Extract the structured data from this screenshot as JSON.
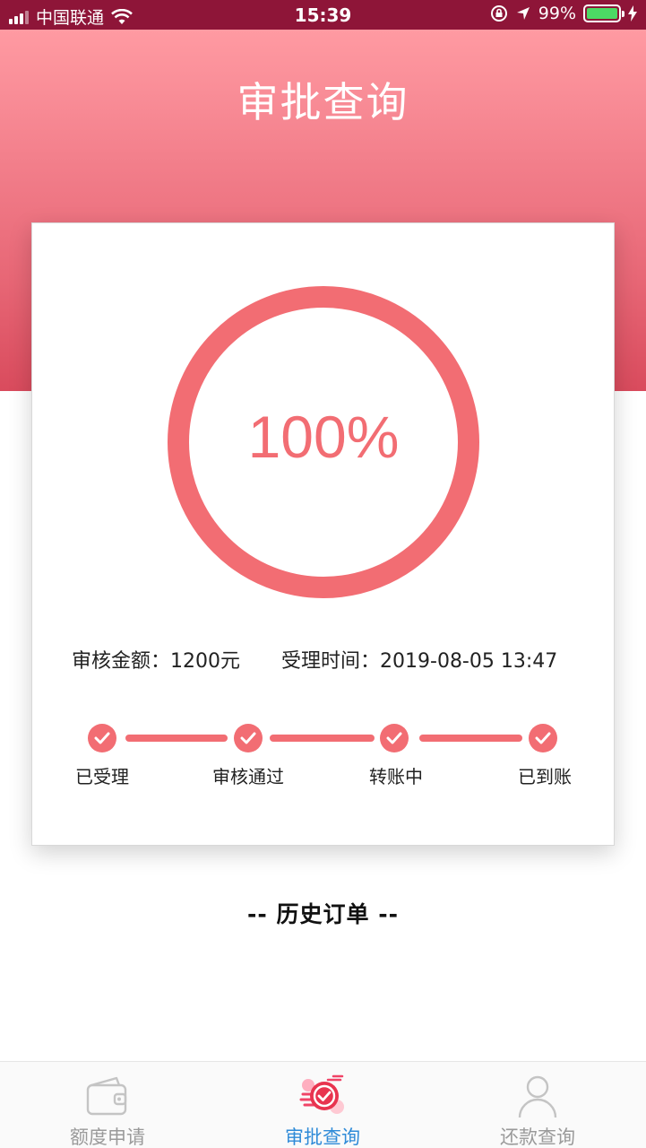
{
  "status_bar": {
    "carrier": "中国联通",
    "time": "15:39",
    "battery": "99%"
  },
  "header": {
    "title": "审批查询"
  },
  "progress": {
    "percent_text": "100%",
    "value": 1.0
  },
  "info": {
    "amount_label": "审核金额：",
    "amount_value": "1200元",
    "time_label": "受理时间：",
    "time_value": "2019-08-05 13:47"
  },
  "steps": [
    {
      "label": "已受理"
    },
    {
      "label": "审核通过"
    },
    {
      "label": "转账中"
    },
    {
      "label": "已到账"
    }
  ],
  "history": {
    "title": "-- 历史订单 --"
  },
  "tabs": [
    {
      "label": "额度申请",
      "icon": "wallet-icon"
    },
    {
      "label": "审批查询",
      "icon": "approval-check-icon"
    },
    {
      "label": "还款查询",
      "icon": "user-icon"
    }
  ],
  "colors": {
    "accent": "#f26d73",
    "active_tab": "#2f8bd8",
    "status_bar": "#8e1538"
  }
}
